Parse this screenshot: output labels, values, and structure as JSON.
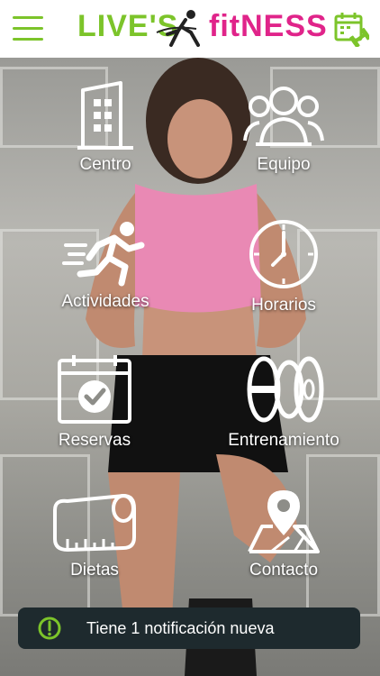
{
  "header": {
    "logo_word_left": "LIVE'S",
    "logo_word_right": "fitNESS",
    "menu_icon": "hamburger-menu-icon",
    "calendar_icon": "calendar-dumbbell-icon"
  },
  "menu": [
    {
      "label": "Centro",
      "icon": "building-icon"
    },
    {
      "label": "Equipo",
      "icon": "group-icon"
    },
    {
      "label": "Actividades",
      "icon": "running-person-icon"
    },
    {
      "label": "Horarios",
      "icon": "clock-icon"
    },
    {
      "label": "Reservas",
      "icon": "calendar-check-icon"
    },
    {
      "label": "Entrenamiento",
      "icon": "weight-plates-icon"
    },
    {
      "label": "Dietas",
      "icon": "measuring-tape-icon"
    },
    {
      "label": "Contacto",
      "icon": "map-pin-icon"
    }
  ],
  "notification": {
    "text": "Tiene 1 notificación nueva",
    "icon": "alert-icon"
  },
  "colors": {
    "green": "#7cc42a",
    "magenta": "#e0248a",
    "notif_bg": "#1e2a2e"
  }
}
